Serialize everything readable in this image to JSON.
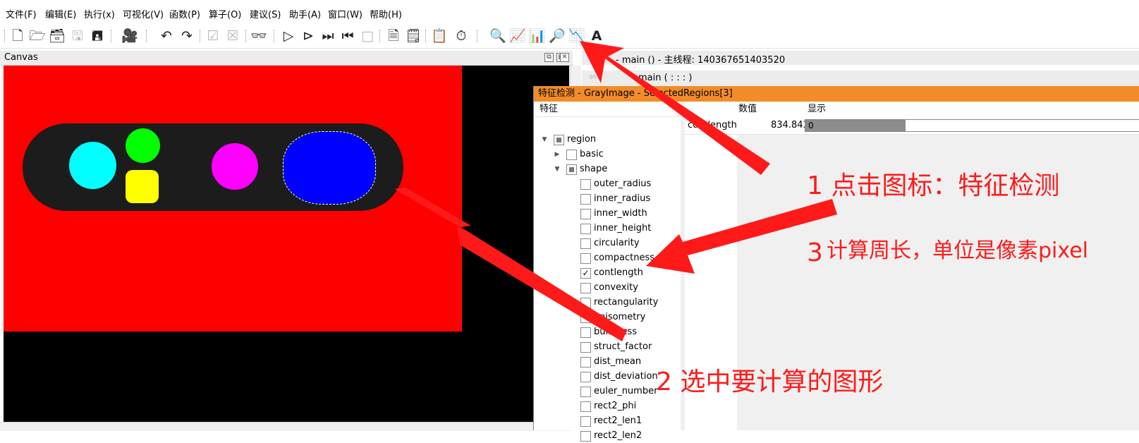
{
  "menu": [
    "文件(F)",
    "编辑(E)",
    "执行(x)",
    "可视化(V)",
    "函数(P)",
    "算子(O)",
    "建议(S)",
    "助手(A)",
    "窗口(W)",
    "帮助(H)"
  ],
  "toolbar": {
    "icons": [
      "new-file-icon",
      "open-file-icon",
      "open-example-icon",
      "save-disabled-icon",
      "save-all-icon",
      "camera-icon",
      "undo-icon",
      "redo-icon",
      "check-disabled-icon",
      "check2-disabled-icon",
      "binoculars-icon",
      "run-icon",
      "step-icon",
      "step-over-icon",
      "step-back-icon",
      "stop-disabled-icon",
      "cursor-doc-icon",
      "list-doc-icon",
      "insert-icon",
      "timer-icon",
      "zoom-icon",
      "gray-histogram-icon",
      "histogram-icon",
      "feature-inspection-icon",
      "line-profile-icon",
      "ocr-icon"
    ]
  },
  "canvas": {
    "title": "Canvas"
  },
  "main_panel": {
    "title": "- main () - 主线程: 140367651403520",
    "sub": "main ( : : : )"
  },
  "dialog": {
    "title": "特征检测 - GrayImage - SelectedRegions[3]",
    "tree_header": "特征",
    "tree": [
      {
        "label": "region",
        "level": 0,
        "arrow": "down",
        "state": "partial"
      },
      {
        "label": "basic",
        "level": 1,
        "arrow": "right",
        "state": "unchecked"
      },
      {
        "label": "shape",
        "level": 1,
        "arrow": "down",
        "state": "partial"
      },
      {
        "label": "outer_radius",
        "level": 2,
        "state": "unchecked"
      },
      {
        "label": "inner_radius",
        "level": 2,
        "state": "unchecked"
      },
      {
        "label": "inner_width",
        "level": 2,
        "state": "unchecked"
      },
      {
        "label": "inner_height",
        "level": 2,
        "state": "unchecked"
      },
      {
        "label": "circularity",
        "level": 2,
        "state": "unchecked"
      },
      {
        "label": "compactness",
        "level": 2,
        "state": "unchecked"
      },
      {
        "label": "contlength",
        "level": 2,
        "state": "checked"
      },
      {
        "label": "convexity",
        "level": 2,
        "state": "unchecked"
      },
      {
        "label": "rectangularity",
        "level": 2,
        "state": "unchecked"
      },
      {
        "label": "anisometry",
        "level": 2,
        "state": "unchecked"
      },
      {
        "label": "bulkiness",
        "level": 2,
        "state": "unchecked"
      },
      {
        "label": "struct_factor",
        "level": 2,
        "state": "unchecked"
      },
      {
        "label": "dist_mean",
        "level": 2,
        "state": "unchecked"
      },
      {
        "label": "dist_deviation",
        "level": 2,
        "state": "unchecked"
      },
      {
        "label": "euler_number",
        "level": 2,
        "state": "unchecked"
      },
      {
        "label": "rect2_phi",
        "level": 2,
        "state": "unchecked"
      },
      {
        "label": "rect2_len1",
        "level": 2,
        "state": "unchecked"
      },
      {
        "label": "rect2_len2",
        "level": 2,
        "state": "unchecked"
      }
    ],
    "columns": {
      "value": "数值",
      "display": "显示"
    },
    "row": {
      "feature": "contlength",
      "value": "834.843",
      "bar_text": "0",
      "bar_fraction": 0.3
    }
  },
  "annotations": {
    "step1": "1 点击图标：特征检测",
    "step2": "2 选中要计算的图形",
    "step3_num": "3",
    "step3_text": "计算周长，单位是像素pixel"
  },
  "colors": {
    "title_bar": "#f28c28",
    "annotation": "#ff1a1a",
    "canvas_bg": "#000000",
    "image_bg": "#ff0000",
    "shape_cyan": "#00ffff",
    "shape_green": "#00ff00",
    "shape_yellow": "#ffff00",
    "shape_magenta": "#ff00ff",
    "shape_blue": "#0000ff"
  }
}
